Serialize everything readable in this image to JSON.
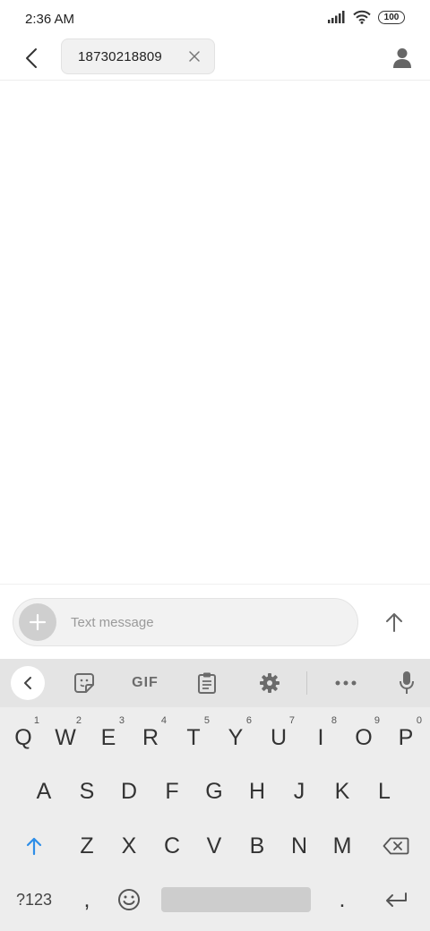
{
  "status_bar": {
    "time": "2:36 AM",
    "battery": "100"
  },
  "header": {
    "recipient": "18730218809"
  },
  "compose": {
    "placeholder": "Text message",
    "value": ""
  },
  "keyboard": {
    "accent_color": "#2e8ee8",
    "row1": [
      {
        "label": "Q",
        "hint": "1"
      },
      {
        "label": "W",
        "hint": "2"
      },
      {
        "label": "E",
        "hint": "3"
      },
      {
        "label": "R",
        "hint": "4"
      },
      {
        "label": "T",
        "hint": "5"
      },
      {
        "label": "Y",
        "hint": "6"
      },
      {
        "label": "U",
        "hint": "7"
      },
      {
        "label": "I",
        "hint": "8"
      },
      {
        "label": "O",
        "hint": "9"
      },
      {
        "label": "P",
        "hint": "0"
      }
    ],
    "row2": [
      "A",
      "S",
      "D",
      "F",
      "G",
      "H",
      "J",
      "K",
      "L"
    ],
    "row3": [
      "Z",
      "X",
      "C",
      "V",
      "B",
      "N",
      "M"
    ],
    "gif_label": "GIF",
    "symbols_label": "?123",
    "comma_label": ",",
    "period_label": "."
  }
}
